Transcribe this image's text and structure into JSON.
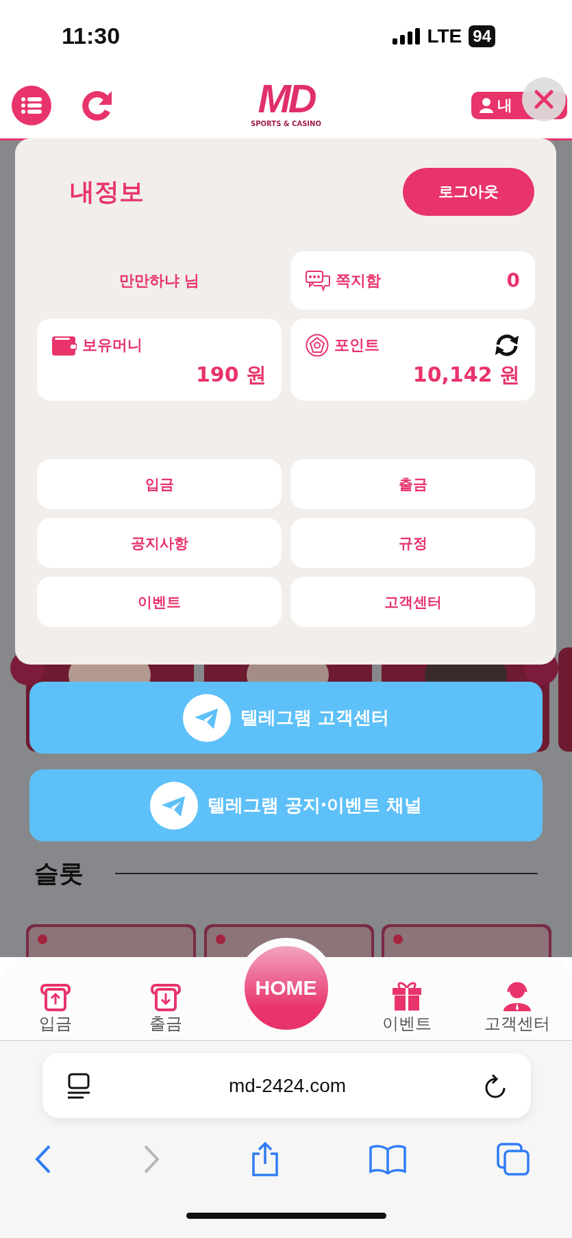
{
  "status_bar": {
    "time": "11:30",
    "network": "LTE",
    "battery": "94"
  },
  "header": {
    "logo": {
      "mark": "MD",
      "tagline": "SPORTS & CASINO"
    },
    "account_button": "내"
  },
  "background": {
    "section_title": "슬롯"
  },
  "my_info": {
    "title": "내정보",
    "logout": "로그아웃",
    "nickname": "만만하냐 님",
    "messages": {
      "label": "쪽지함",
      "count": "0"
    },
    "balances": [
      {
        "kind": "money",
        "label": "보유머니",
        "amount": "190 원",
        "refresh": false
      },
      {
        "kind": "points",
        "label": "포인트",
        "amount": "10,142 원",
        "refresh": true
      }
    ],
    "menu": [
      "입금",
      "출금",
      "공지사항",
      "규정",
      "이벤트",
      "고객센터"
    ]
  },
  "telegram_buttons": [
    "텔레그램 고객센터",
    "텔레그램 공지·이벤트 채널"
  ],
  "bottom_nav": [
    {
      "kind": "deposit",
      "label": "입금"
    },
    {
      "kind": "withdraw",
      "label": "출금"
    },
    {
      "kind": "home",
      "label": "HOME"
    },
    {
      "kind": "event",
      "label": "이벤트"
    },
    {
      "kind": "support",
      "label": "고객센터"
    }
  ],
  "browser": {
    "url": "md-2424.com"
  }
}
